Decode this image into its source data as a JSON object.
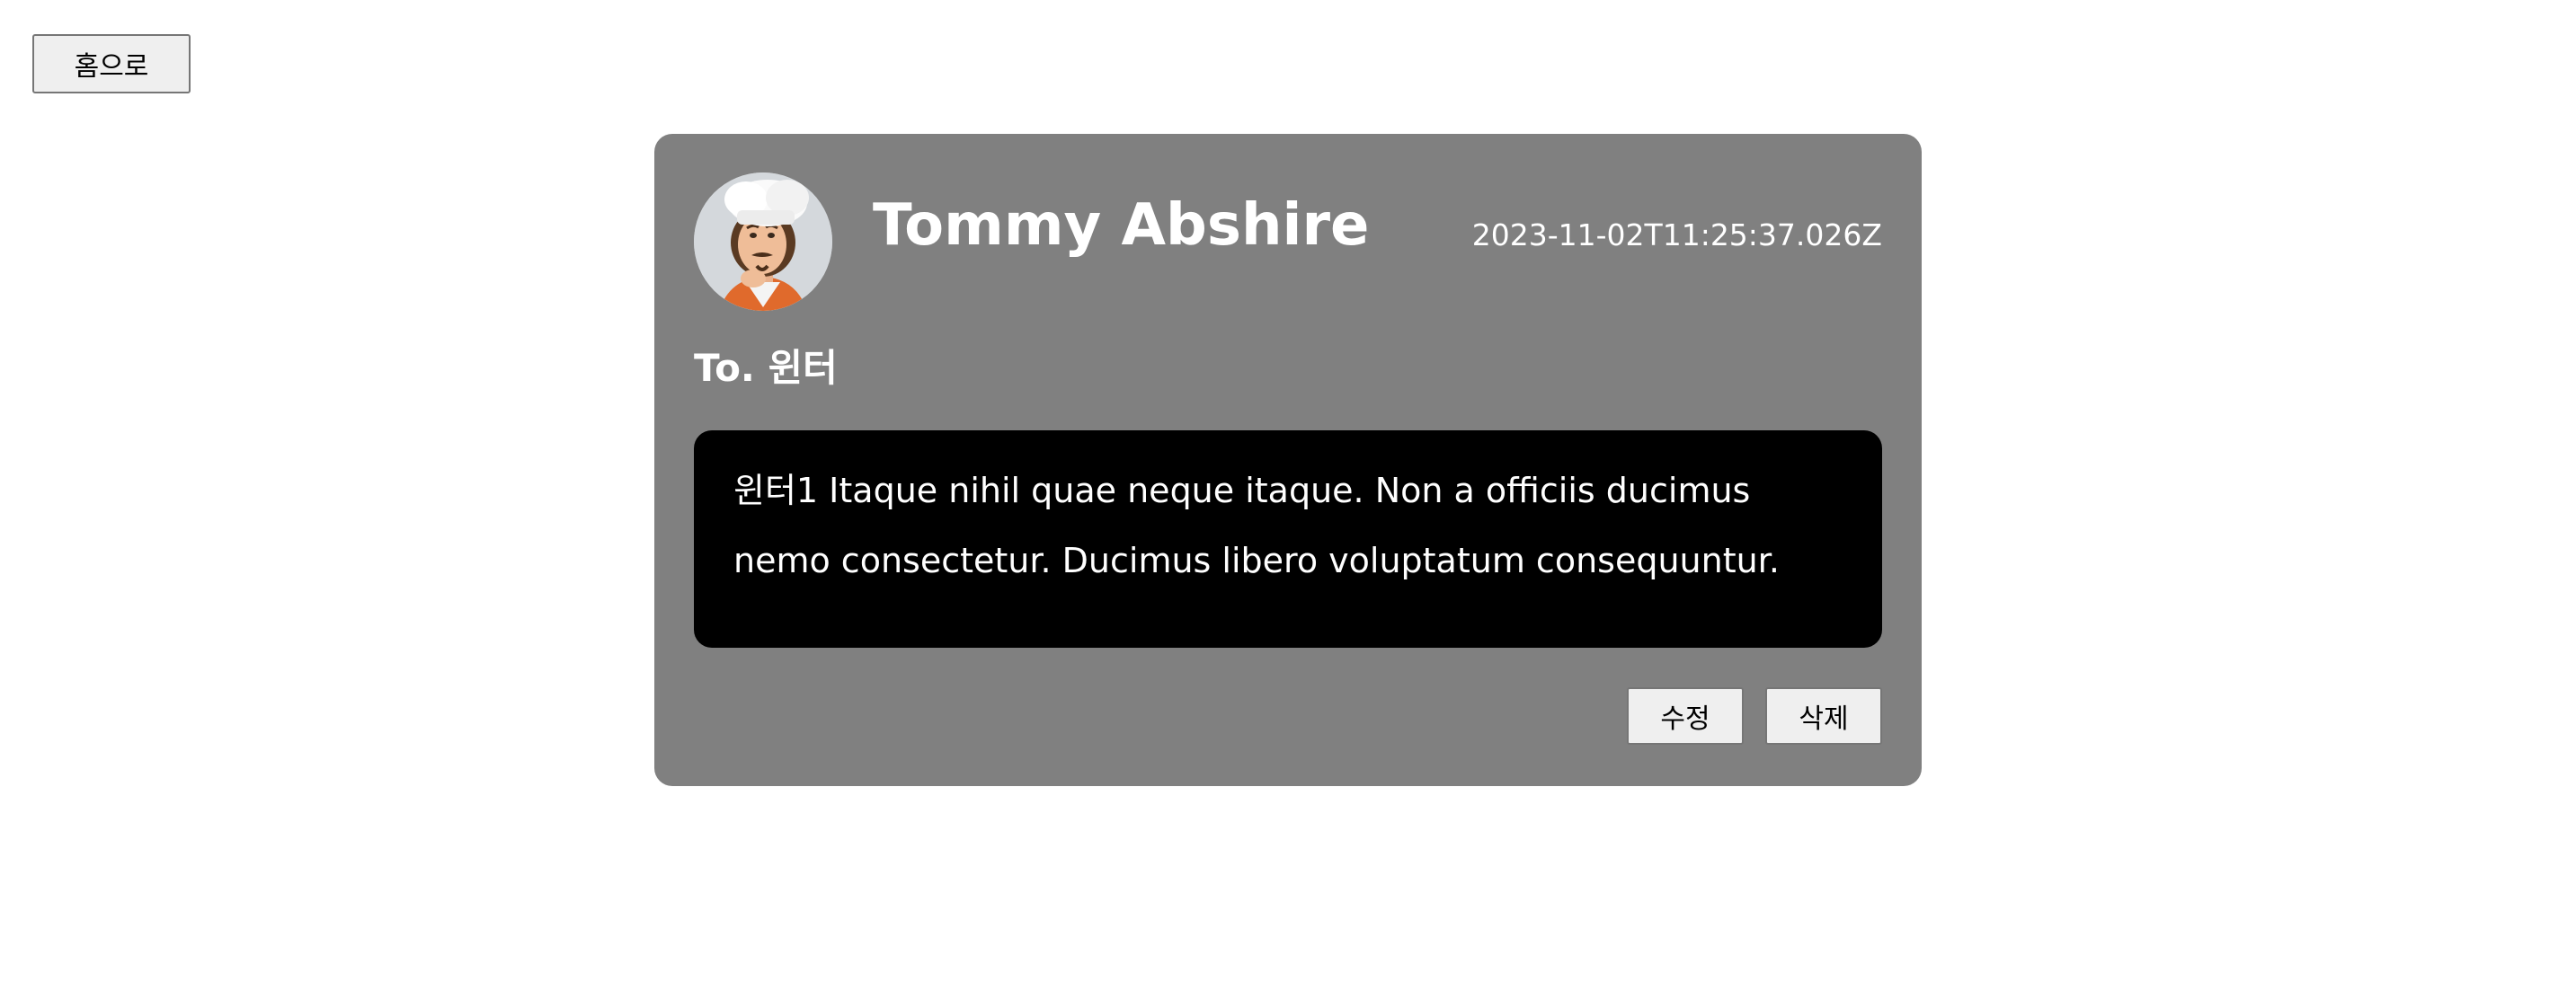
{
  "nav": {
    "home_label": "홈으로"
  },
  "post": {
    "author_name": "Tommy Abshire",
    "created_at": "2023-11-02T11:25:37.026Z",
    "recipient_prefix": "To. 윈터",
    "message": "윈터1 Itaque nihil quae neque itaque. Non a officiis ducimus nemo consectetur. Ducimus libero voluptatum consequuntur.",
    "avatar_icon": "chef-avatar",
    "actions": {
      "edit_label": "수정",
      "delete_label": "삭제"
    }
  },
  "colors": {
    "card_background": "#808080",
    "message_background": "#000000",
    "text": "#ffffff",
    "button_background": "#efefef"
  }
}
